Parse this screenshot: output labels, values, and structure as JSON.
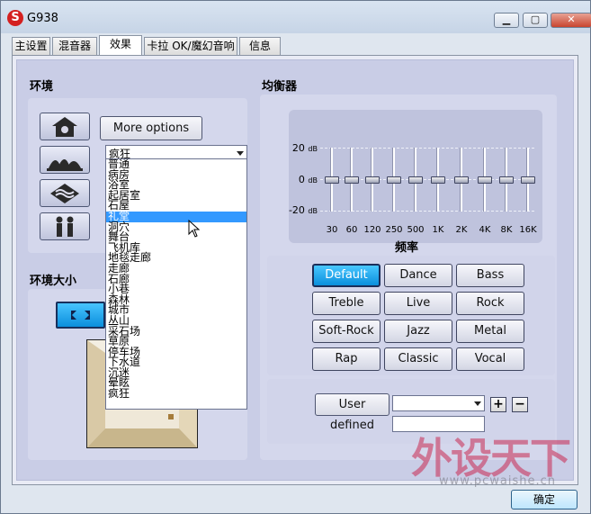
{
  "window": {
    "title": "G938",
    "logo_letter": "S"
  },
  "titlebar_buttons": {
    "minimize": "▁",
    "maximize": "▢",
    "close": "✕"
  },
  "tabs": [
    {
      "label": "主设置"
    },
    {
      "label": "混音器"
    },
    {
      "label": "效果"
    },
    {
      "label": "卡拉 OK/魔幻音响"
    },
    {
      "label": "信息"
    }
  ],
  "environment": {
    "title": "环境",
    "more_options_label": "More options",
    "selected": "疯狂",
    "options": [
      "普通",
      "病房",
      "浴室",
      "起居室",
      "石屋",
      "礼堂",
      "洞穴",
      "舞台",
      "飞机库",
      "地毯走廊",
      "走廊",
      "石廊",
      "小巷",
      "森林",
      "城市",
      "丛山",
      "采石场",
      "草原",
      "停车场",
      "下水道",
      "沉迷",
      "晕眩",
      "疯狂"
    ],
    "highlighted": "礼堂",
    "icons": [
      "house-icon",
      "opera-house-icon",
      "underwater-icon",
      "people-icon"
    ]
  },
  "environment_size": {
    "title": "环境大小",
    "expand_icon": "expand-arrows-icon"
  },
  "equalizer": {
    "title": "均衡器",
    "db_labels": [
      {
        "value": "20",
        "unit": "dB"
      },
      {
        "value": "0",
        "unit": "dB"
      },
      {
        "value": "-20",
        "unit": "dB"
      }
    ],
    "bands": [
      {
        "freq": "30",
        "level": 0
      },
      {
        "freq": "60",
        "level": 0
      },
      {
        "freq": "120",
        "level": 0
      },
      {
        "freq": "250",
        "level": 0
      },
      {
        "freq": "500",
        "level": 0
      },
      {
        "freq": "1K",
        "level": 0
      },
      {
        "freq": "2K",
        "level": 0
      },
      {
        "freq": "4K",
        "level": 0
      },
      {
        "freq": "8K",
        "level": 0
      },
      {
        "freq": "16K",
        "level": 0
      }
    ],
    "freq_axis_label": "频率",
    "presets": [
      "Default",
      "Dance",
      "Bass",
      "Treble",
      "Live",
      "Rock",
      "Soft-Rock",
      "Jazz",
      "Metal",
      "Rap",
      "Classic",
      "Vocal"
    ],
    "active_preset": "Default",
    "user_defined_label": "User defined",
    "user_select_value": "",
    "name_input_value": "",
    "plus_label": "+",
    "minus_label": "−"
  },
  "watermark": {
    "text": "外设天下",
    "url_text": "www.pcwaishe.cn"
  },
  "ok_label": "确定",
  "colors": {
    "accent": "#3399ff",
    "active_preset": "#19a6f0",
    "panel": "#c9cde6"
  }
}
